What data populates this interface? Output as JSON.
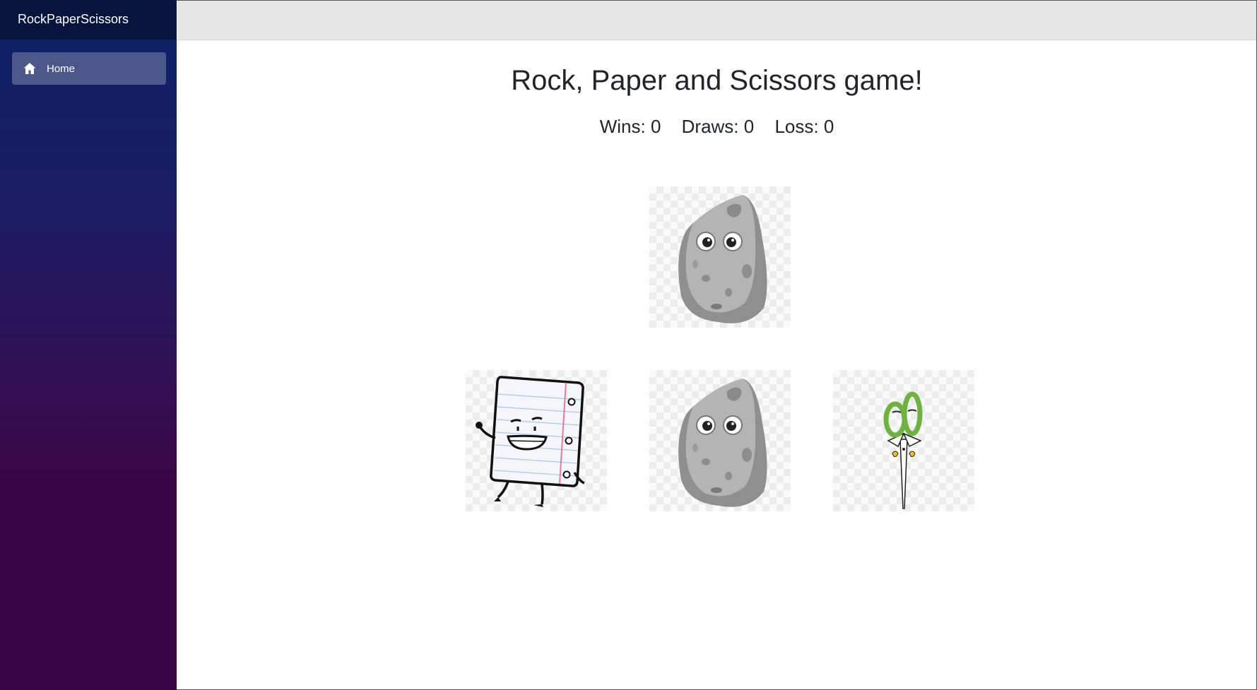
{
  "app": {
    "brand": "RockPaperScissors"
  },
  "sidebar": {
    "items": [
      {
        "label": "Home",
        "icon": "home-icon",
        "active": true
      }
    ]
  },
  "game": {
    "title": "Rock, Paper and Scissors game!",
    "scores": {
      "wins_label": "Wins: 0",
      "draws_label": "Draws: 0",
      "loss_label": "Loss: 0"
    },
    "computer_choice": "rock",
    "choices": [
      "paper",
      "rock",
      "scissors"
    ]
  },
  "colors": {
    "sidebar_top": "#0c2366",
    "sidebar_bottom": "#3a0647",
    "topbar": "#e5e5e5",
    "scissors_handle": "#6db33f"
  }
}
